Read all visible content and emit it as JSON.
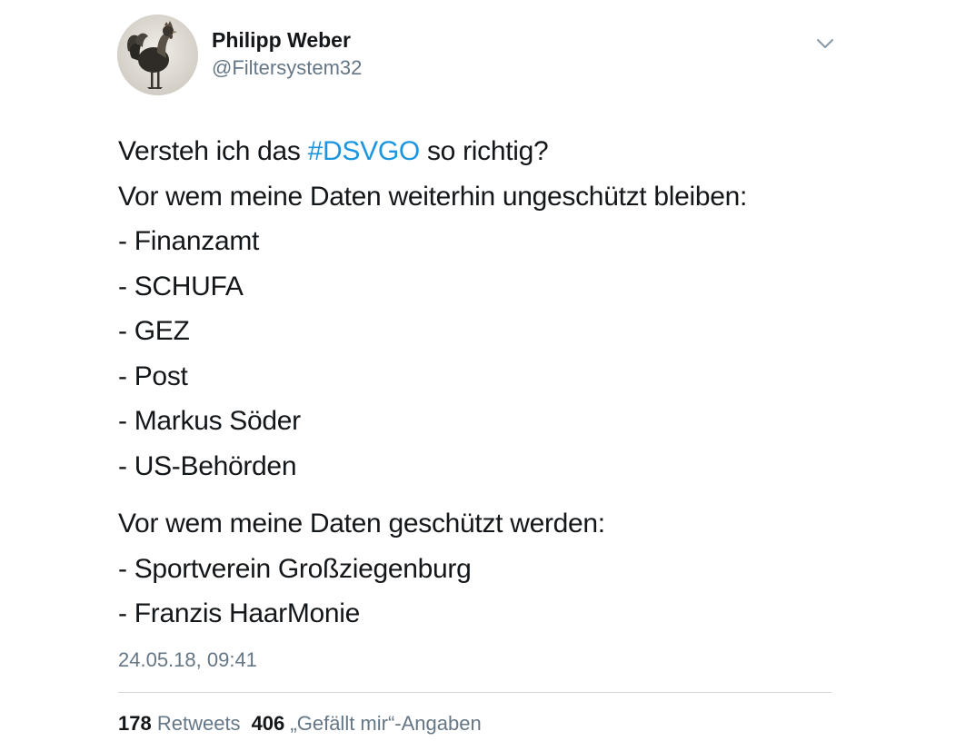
{
  "author": {
    "name": "Philipp Weber",
    "handle": "@Filtersystem32"
  },
  "tweet": {
    "line1_prefix": "Versteh ich das ",
    "hashtag": "#DSVGO",
    "line1_suffix": " so richtig?",
    "intro_unprotected": "Vor wem meine Daten weiterhin ungeschützt bleiben:",
    "unprotected": [
      "- Finanzamt",
      "- SCHUFA",
      "- GEZ",
      "- Post",
      "- Markus Söder",
      "- US-Behörden"
    ],
    "intro_protected": "Vor wem meine Daten geschützt werden:",
    "protected": [
      "- Sportverein Großziegenburg",
      "- Franzis HaarMonie"
    ],
    "timestamp": "24.05.18, 09:41"
  },
  "stats": {
    "retweets_count": "178",
    "retweets_label": "Retweets",
    "likes_count": "406",
    "likes_label": "„Gefällt mir“-Angaben"
  },
  "colors": {
    "hashtag": "#1b95e0",
    "secondary_text": "#657786",
    "primary_text": "#14171a"
  },
  "icons": {
    "menu": "chevron-down-icon"
  }
}
